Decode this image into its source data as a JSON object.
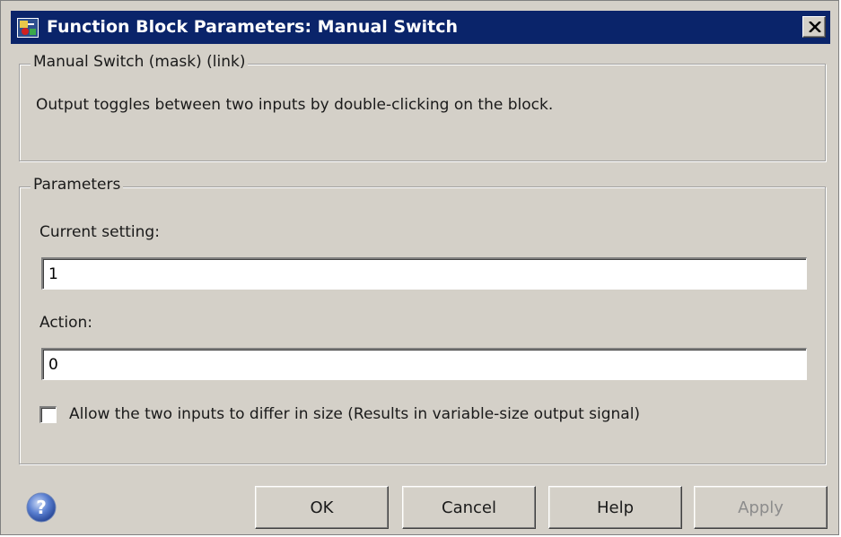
{
  "window": {
    "title": "Function Block Parameters: Manual Switch",
    "close_label": "close"
  },
  "description_group": {
    "legend": "Manual Switch (mask) (link)",
    "text": "Output toggles between two inputs by double-clicking on the block."
  },
  "parameters_group": {
    "legend": "Parameters",
    "current_setting": {
      "label": "Current setting:",
      "value": "1"
    },
    "action": {
      "label": "Action:",
      "value": "0"
    },
    "allow_differ": {
      "label": "Allow the two inputs to differ in size (Results in variable-size output signal)",
      "checked": false
    }
  },
  "buttons": {
    "ok": "OK",
    "cancel": "Cancel",
    "help": "Help",
    "apply": "Apply"
  },
  "colors": {
    "titlebar": "#0a246a",
    "dialog_bg": "#d4d0c8",
    "disabled_text": "#8c8c8c"
  },
  "icons": {
    "title": "simulink-block-icon",
    "close": "close-icon",
    "help": "help-question-icon"
  }
}
